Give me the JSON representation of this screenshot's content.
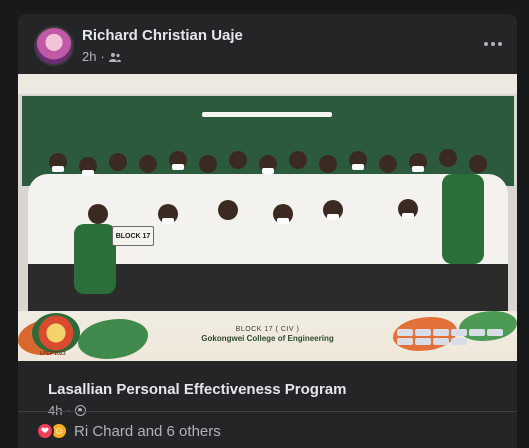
{
  "post": {
    "author": "Richard Christian Uaje",
    "time": "2h",
    "audience_icon": "friends-icon",
    "more_icon": "more-dots-icon"
  },
  "photo": {
    "sign_text": "BLOCK 17",
    "caption_block": "BLOCK  17  ( CIV )",
    "caption_college": "Gokongwei College of Engineering",
    "logo_text": "LPEP 2023"
  },
  "shared": {
    "title": "Lasallian Personal Effectiveness Program",
    "time": "4h",
    "audience_icon": "globe-icon"
  },
  "reactions": {
    "icons": [
      "love-icon",
      "care-icon"
    ],
    "summary": "Ri Chard and 6 others"
  },
  "colors": {
    "background": "#18191a",
    "card": "#242526",
    "text_primary": "#e4e6eb",
    "text_secondary": "#b0b3b8",
    "love": "#f33e58",
    "care": "#f7b125"
  }
}
